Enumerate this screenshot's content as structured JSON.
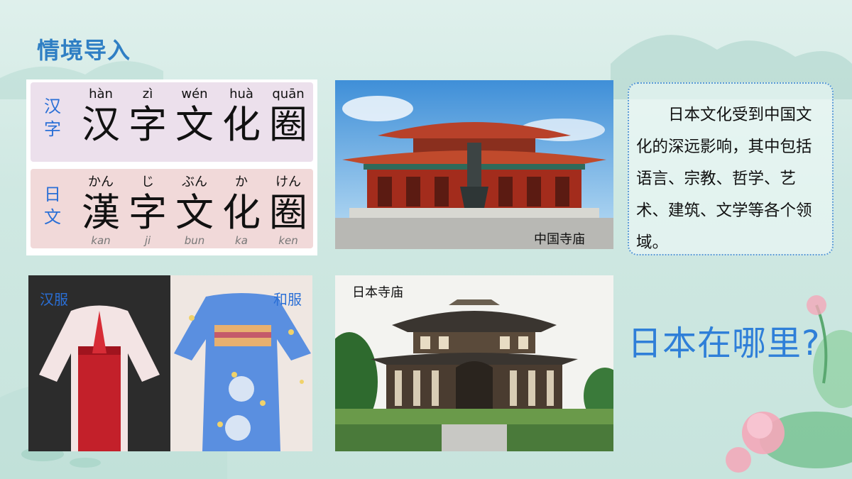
{
  "slide": {
    "title": "情境导入"
  },
  "hanzi_card": {
    "chinese_row": {
      "side_label_1": "汉",
      "side_label_2": "字",
      "pinyin": [
        "hàn",
        "zì",
        "wén",
        "huà",
        "quān"
      ],
      "characters": [
        "汉",
        "字",
        "文",
        "化",
        "圈"
      ]
    },
    "japanese_row": {
      "side_label_1": "日",
      "side_label_2": "文",
      "kana": [
        "かん",
        "じ",
        "ぶん",
        "か",
        "けん"
      ],
      "characters": [
        "漢",
        "字",
        "文",
        "化",
        "圈"
      ],
      "romaji": [
        "kan",
        "ji",
        "bun",
        "ka",
        "ken"
      ]
    }
  },
  "photos": {
    "chinese_temple_caption": "中国寺庙",
    "japanese_temple_caption": "日本寺庙",
    "hanfu_caption": "汉服",
    "kimono_caption": "和服"
  },
  "info_box": {
    "text": "日本文化受到中国文化的深远影响，其中包括语言、宗教、哲学、艺术、建筑、文学等各个领域。"
  },
  "question": "日本在哪里?",
  "colors": {
    "title": "#2f7fc4",
    "accent_blue": "#2a6fd6",
    "background": "#cfe8e2"
  }
}
